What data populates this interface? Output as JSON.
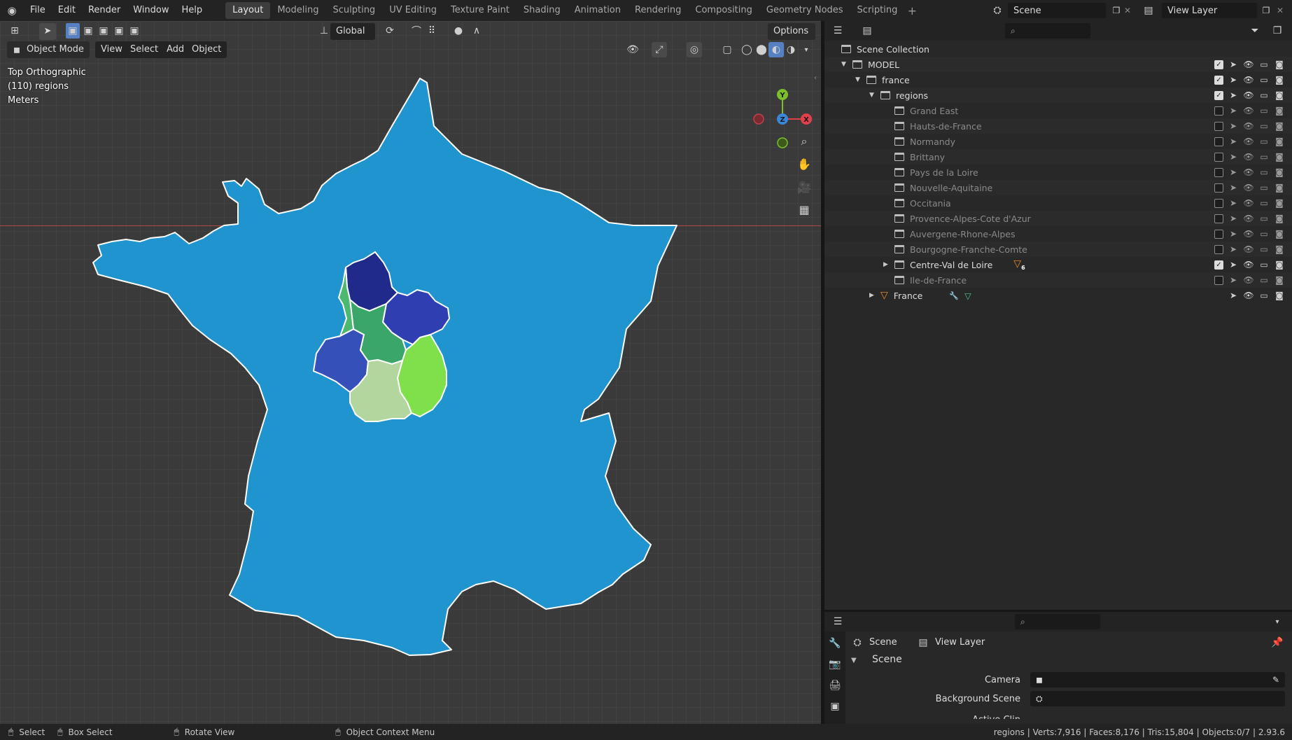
{
  "menu": [
    "File",
    "Edit",
    "Render",
    "Window",
    "Help"
  ],
  "workspaces": [
    "Layout",
    "Modeling",
    "Sculpting",
    "UV Editing",
    "Texture Paint",
    "Shading",
    "Animation",
    "Rendering",
    "Compositing",
    "Geometry Nodes",
    "Scripting"
  ],
  "active_workspace": "Layout",
  "scene_name": "Scene",
  "view_layer": "View Layer",
  "viewport": {
    "transform_orientation": "Global",
    "options_label": "Options",
    "mode": "Object Mode",
    "header_menus": [
      "View",
      "Select",
      "Add",
      "Object"
    ],
    "overlay_lines": [
      "Top Orthographic",
      "(110) regions",
      "Meters"
    ],
    "gizmo_axes": {
      "x": "X",
      "y": "Y",
      "z": "Z"
    }
  },
  "colors": {
    "france": "#1f94cf",
    "region_1": "#1f2a8a",
    "region_2": "#2f3fb2",
    "region_3": "#3550b8",
    "region_4": "#3aa66a",
    "region_5": "#80e04c",
    "region_6": "#b3d69e",
    "region_7": "#4cb870",
    "axis_x": "#e0404a",
    "axis_y": "#7cbf2b",
    "axis_z": "#3a86d8"
  },
  "outliner": {
    "root": "Scene Collection",
    "rows": [
      {
        "label": "MODEL",
        "level": 1,
        "expanded": true,
        "type": "collection",
        "checked": true,
        "dim": false
      },
      {
        "label": "france",
        "level": 2,
        "expanded": true,
        "type": "collection",
        "checked": true,
        "dim": false
      },
      {
        "label": "regions",
        "level": 3,
        "expanded": true,
        "type": "collection",
        "checked": true,
        "dim": false
      },
      {
        "label": "Grand East",
        "level": 4,
        "type": "collection",
        "checked": false,
        "dim": true
      },
      {
        "label": "Hauts-de-France",
        "level": 4,
        "type": "collection",
        "checked": false,
        "dim": true
      },
      {
        "label": "Normandy",
        "level": 4,
        "type": "collection",
        "checked": false,
        "dim": true
      },
      {
        "label": "Brittany",
        "level": 4,
        "type": "collection",
        "checked": false,
        "dim": true
      },
      {
        "label": "Pays de la Loire",
        "level": 4,
        "type": "collection",
        "checked": false,
        "dim": true
      },
      {
        "label": "Nouvelle-Aquitaine",
        "level": 4,
        "type": "collection",
        "checked": false,
        "dim": true
      },
      {
        "label": "Occitania",
        "level": 4,
        "type": "collection",
        "checked": false,
        "dim": true
      },
      {
        "label": "Provence-Alpes-Cote d'Azur",
        "level": 4,
        "type": "collection",
        "checked": false,
        "dim": true
      },
      {
        "label": "Auvergene-Rhone-Alpes",
        "level": 4,
        "type": "collection",
        "checked": false,
        "dim": true
      },
      {
        "label": "Bourgogne-Franche-Comte",
        "level": 4,
        "type": "collection",
        "checked": false,
        "dim": true
      },
      {
        "label": "Centre-Val de Loire",
        "level": 4,
        "type": "collection",
        "checked": true,
        "dim": false,
        "collapsed_arrow": true,
        "badge": "6"
      },
      {
        "label": "Ile-de-France",
        "level": 4,
        "type": "collection",
        "checked": false,
        "dim": true
      },
      {
        "label": "France",
        "level": 3,
        "type": "object",
        "dim": false,
        "collapsed_arrow": true
      }
    ]
  },
  "properties": {
    "tabs": [
      "Scene",
      "View Layer"
    ],
    "panel_title": "Scene",
    "fields": [
      {
        "label": "Camera",
        "value": ""
      },
      {
        "label": "Background Scene",
        "value": ""
      }
    ],
    "cut_off_label": "Active Clip"
  },
  "status": {
    "hints": [
      "Select",
      "Box Select",
      "Rotate View",
      "Object Context Menu"
    ],
    "stats": "regions | Verts:7,916 | Faces:8,176 | Tris:15,804 | Objects:0/7 | 2.93.6"
  }
}
